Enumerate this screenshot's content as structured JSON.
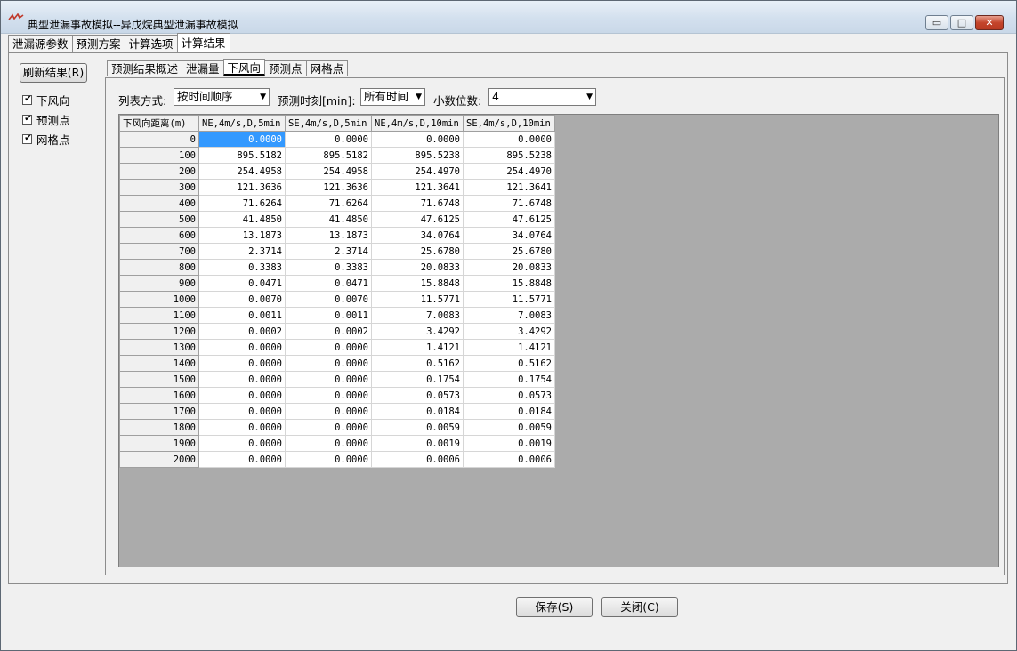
{
  "window": {
    "title": "典型泄漏事故模拟--异戊烷典型泄漏事故模拟",
    "minimize_glyph": "▭",
    "maximize_glyph": "□",
    "close_glyph": "✕"
  },
  "outer_tabs": [
    {
      "label": "泄漏源参数"
    },
    {
      "label": "预测方案"
    },
    {
      "label": "计算选项"
    },
    {
      "label": "计算结果"
    }
  ],
  "side_panel": {
    "refresh_label": "刷新结果(R)",
    "checkboxes": [
      {
        "label": "下风向",
        "checked": true
      },
      {
        "label": "预测点",
        "checked": true
      },
      {
        "label": "网格点",
        "checked": true
      }
    ]
  },
  "inner_tabs": [
    {
      "label": "预测结果概述"
    },
    {
      "label": "泄漏量"
    },
    {
      "label": "下风向"
    },
    {
      "label": "预测点"
    },
    {
      "label": "网格点"
    }
  ],
  "controls": {
    "list_mode_label": "列表方式:",
    "list_mode_value": "按时间顺序",
    "time_label": "预测时刻[min]:",
    "time_value": "所有时间",
    "decimals_label": "小数位数:",
    "decimals_value": "4"
  },
  "grid": {
    "columns": [
      "下风向距离(m)",
      "NE,4m/s,D,5min",
      "SE,4m/s,D,5min",
      "NE,4m/s,D,10min",
      "SE,4m/s,D,10min"
    ],
    "rows": [
      [
        "0",
        "0.0000",
        "0.0000",
        "0.0000",
        "0.0000"
      ],
      [
        "100",
        "895.5182",
        "895.5182",
        "895.5238",
        "895.5238"
      ],
      [
        "200",
        "254.4958",
        "254.4958",
        "254.4970",
        "254.4970"
      ],
      [
        "300",
        "121.3636",
        "121.3636",
        "121.3641",
        "121.3641"
      ],
      [
        "400",
        "71.6264",
        "71.6264",
        "71.6748",
        "71.6748"
      ],
      [
        "500",
        "41.4850",
        "41.4850",
        "47.6125",
        "47.6125"
      ],
      [
        "600",
        "13.1873",
        "13.1873",
        "34.0764",
        "34.0764"
      ],
      [
        "700",
        "2.3714",
        "2.3714",
        "25.6780",
        "25.6780"
      ],
      [
        "800",
        "0.3383",
        "0.3383",
        "20.0833",
        "20.0833"
      ],
      [
        "900",
        "0.0471",
        "0.0471",
        "15.8848",
        "15.8848"
      ],
      [
        "1000",
        "0.0070",
        "0.0070",
        "11.5771",
        "11.5771"
      ],
      [
        "1100",
        "0.0011",
        "0.0011",
        "7.0083",
        "7.0083"
      ],
      [
        "1200",
        "0.0002",
        "0.0002",
        "3.4292",
        "3.4292"
      ],
      [
        "1300",
        "0.0000",
        "0.0000",
        "1.4121",
        "1.4121"
      ],
      [
        "1400",
        "0.0000",
        "0.0000",
        "0.5162",
        "0.5162"
      ],
      [
        "1500",
        "0.0000",
        "0.0000",
        "0.1754",
        "0.1754"
      ],
      [
        "1600",
        "0.0000",
        "0.0000",
        "0.0573",
        "0.0573"
      ],
      [
        "1700",
        "0.0000",
        "0.0000",
        "0.0184",
        "0.0184"
      ],
      [
        "1800",
        "0.0000",
        "0.0000",
        "0.0059",
        "0.0059"
      ],
      [
        "1900",
        "0.0000",
        "0.0000",
        "0.0019",
        "0.0019"
      ],
      [
        "2000",
        "0.0000",
        "0.0000",
        "0.0006",
        "0.0006"
      ]
    ]
  },
  "footer": {
    "save_label": "保存(S)",
    "close_label": "关闭(C)"
  },
  "colors": {
    "selection": "#3399ff",
    "grid_background": "#ababab"
  }
}
